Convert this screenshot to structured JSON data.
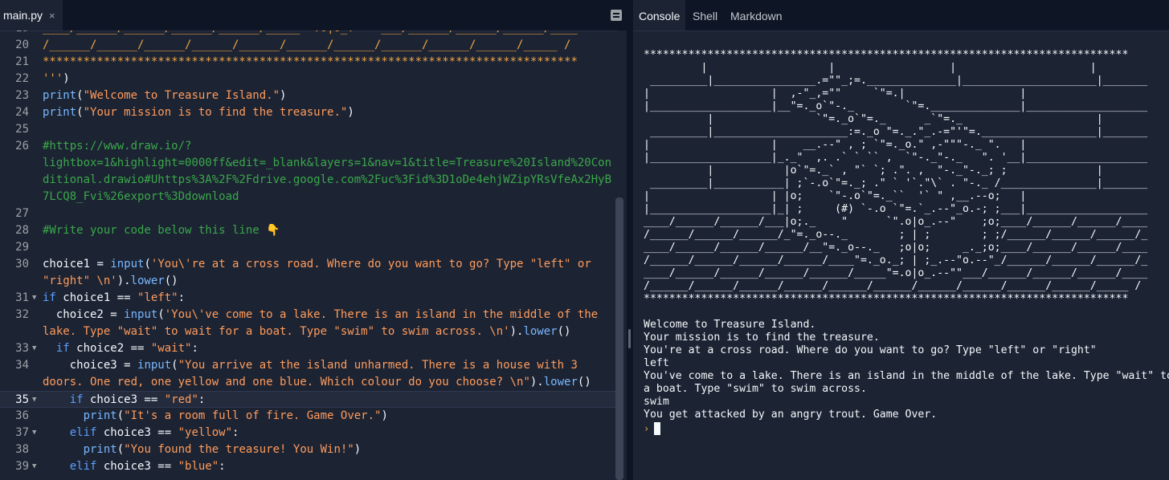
{
  "editor": {
    "file_tab": "main.py",
    "close_glyph": "×",
    "lines": [
      {
        "n": "19",
        "fold": false,
        "active": false,
        "parts": [
          {
            "t": "____/______/______/______/______/_____ =.o|o_.--  ___/______/______/______/____",
            "c": "c-orange"
          }
        ]
      },
      {
        "n": "20",
        "fold": false,
        "active": false,
        "parts": [
          {
            "t": "/______/______/______/______/______/______/______/______/______/______/_____ /",
            "c": "c-orange"
          }
        ]
      },
      {
        "n": "21",
        "fold": false,
        "active": false,
        "parts": [
          {
            "t": "*******************************************************************************",
            "c": "c-orange"
          }
        ]
      },
      {
        "n": "22",
        "fold": false,
        "active": false,
        "parts": [
          {
            "t": "'''",
            "c": "c-orange"
          },
          {
            "t": ")",
            "c": "c-def"
          }
        ]
      },
      {
        "n": "23",
        "fold": false,
        "active": false,
        "parts": [
          {
            "t": "print",
            "c": "c-call"
          },
          {
            "t": "(",
            "c": "c-def"
          },
          {
            "t": "\"Welcome to Treasure Island.\"",
            "c": "c-str"
          },
          {
            "t": ")",
            "c": "c-def"
          }
        ]
      },
      {
        "n": "24",
        "fold": false,
        "active": false,
        "parts": [
          {
            "t": "print",
            "c": "c-call"
          },
          {
            "t": "(",
            "c": "c-def"
          },
          {
            "t": "\"Your mission is to find the treasure.\"",
            "c": "c-str"
          },
          {
            "t": ")",
            "c": "c-def"
          }
        ]
      },
      {
        "n": "25",
        "fold": false,
        "active": false,
        "parts": []
      },
      {
        "n": "26",
        "fold": false,
        "active": false,
        "parts": [
          {
            "t": "#https://www.draw.io/?",
            "c": "c-com"
          }
        ]
      },
      {
        "n": "",
        "fold": false,
        "active": false,
        "parts": [
          {
            "t": "lightbox=1&highlight=0000ff&edit=_blank&layers=1&nav=1&title=Treasure%20Island%20Con",
            "c": "c-com"
          }
        ]
      },
      {
        "n": "",
        "fold": false,
        "active": false,
        "parts": [
          {
            "t": "ditional.drawio#Uhttps%3A%2F%2Fdrive.google.com%2Fuc%3Fid%3D1oDe4ehjWZipYRsVfeAx2HyB",
            "c": "c-com"
          }
        ]
      },
      {
        "n": "",
        "fold": false,
        "active": false,
        "parts": [
          {
            "t": "7LCQ8_Fvi%26export%3Ddownload",
            "c": "c-com"
          }
        ]
      },
      {
        "n": "27",
        "fold": false,
        "active": false,
        "parts": []
      },
      {
        "n": "28",
        "fold": false,
        "active": false,
        "parts": [
          {
            "t": "#Write your code below this line 👇",
            "c": "c-com"
          }
        ]
      },
      {
        "n": "29",
        "fold": false,
        "active": false,
        "parts": []
      },
      {
        "n": "30",
        "fold": false,
        "active": false,
        "parts": [
          {
            "t": "choice1",
            "c": "c-var"
          },
          {
            "t": " = ",
            "c": "c-def"
          },
          {
            "t": "input",
            "c": "c-call"
          },
          {
            "t": "(",
            "c": "c-def"
          },
          {
            "t": "'You\\'re at a cross road. Where do you want to go? Type \"left\" or",
            "c": "c-str"
          }
        ]
      },
      {
        "n": "",
        "fold": false,
        "active": false,
        "parts": [
          {
            "t": "\"right\" \\n'",
            "c": "c-str"
          },
          {
            "t": ").",
            "c": "c-def"
          },
          {
            "t": "lower",
            "c": "c-call"
          },
          {
            "t": "()",
            "c": "c-def"
          }
        ]
      },
      {
        "n": "31",
        "fold": true,
        "active": false,
        "parts": [
          {
            "t": "if",
            "c": "c-kw"
          },
          {
            "t": " choice1 == ",
            "c": "c-def"
          },
          {
            "t": "\"left\"",
            "c": "c-str"
          },
          {
            "t": ":",
            "c": "c-def"
          }
        ]
      },
      {
        "n": "32",
        "fold": false,
        "active": false,
        "parts": [
          {
            "t": "  choice2 = ",
            "c": "c-def"
          },
          {
            "t": "input",
            "c": "c-call"
          },
          {
            "t": "(",
            "c": "c-def"
          },
          {
            "t": "'You\\'ve come to a lake. There is an island in the middle of the",
            "c": "c-str"
          }
        ]
      },
      {
        "n": "",
        "fold": false,
        "active": false,
        "parts": [
          {
            "t": "lake. Type \"wait\" to wait for a boat. Type \"swim\" to swim across. \\n'",
            "c": "c-str"
          },
          {
            "t": ").",
            "c": "c-def"
          },
          {
            "t": "lower",
            "c": "c-call"
          },
          {
            "t": "()",
            "c": "c-def"
          }
        ]
      },
      {
        "n": "33",
        "fold": true,
        "active": false,
        "parts": [
          {
            "t": "  ",
            "c": "c-def"
          },
          {
            "t": "if",
            "c": "c-kw"
          },
          {
            "t": " choice2 == ",
            "c": "c-def"
          },
          {
            "t": "\"wait\"",
            "c": "c-str"
          },
          {
            "t": ":",
            "c": "c-def"
          }
        ]
      },
      {
        "n": "34",
        "fold": false,
        "active": false,
        "parts": [
          {
            "t": "    choice3 = ",
            "c": "c-def"
          },
          {
            "t": "input",
            "c": "c-call"
          },
          {
            "t": "(",
            "c": "c-def"
          },
          {
            "t": "\"You arrive at the island unharmed. There is a house with 3",
            "c": "c-str"
          }
        ]
      },
      {
        "n": "",
        "fold": false,
        "active": false,
        "parts": [
          {
            "t": "doors. One red, one yellow and one blue. Which colour do you choose? \\n\"",
            "c": "c-str"
          },
          {
            "t": ").",
            "c": "c-def"
          },
          {
            "t": "lower",
            "c": "c-call"
          },
          {
            "t": "()",
            "c": "c-def"
          }
        ]
      },
      {
        "n": "35",
        "fold": true,
        "active": true,
        "parts": [
          {
            "t": "    ",
            "c": "c-def"
          },
          {
            "t": "if",
            "c": "c-kw"
          },
          {
            "t": " choice3 == ",
            "c": "c-def"
          },
          {
            "t": "\"red\"",
            "c": "c-str"
          },
          {
            "t": ":",
            "c": "c-def"
          }
        ]
      },
      {
        "n": "36",
        "fold": false,
        "active": false,
        "parts": [
          {
            "t": "      ",
            "c": "c-def"
          },
          {
            "t": "print",
            "c": "c-call"
          },
          {
            "t": "(",
            "c": "c-def"
          },
          {
            "t": "\"It's a room full of fire. Game Over.\"",
            "c": "c-str"
          },
          {
            "t": ")",
            "c": "c-def"
          }
        ]
      },
      {
        "n": "37",
        "fold": true,
        "active": false,
        "parts": [
          {
            "t": "    ",
            "c": "c-def"
          },
          {
            "t": "elif",
            "c": "c-kw"
          },
          {
            "t": " choice3 == ",
            "c": "c-def"
          },
          {
            "t": "\"yellow\"",
            "c": "c-str"
          },
          {
            "t": ":",
            "c": "c-def"
          }
        ]
      },
      {
        "n": "38",
        "fold": false,
        "active": false,
        "parts": [
          {
            "t": "      ",
            "c": "c-def"
          },
          {
            "t": "print",
            "c": "c-call"
          },
          {
            "t": "(",
            "c": "c-def"
          },
          {
            "t": "\"You found the treasure! You Win!\"",
            "c": "c-str"
          },
          {
            "t": ")",
            "c": "c-def"
          }
        ]
      },
      {
        "n": "39",
        "fold": true,
        "active": false,
        "parts": [
          {
            "t": "    ",
            "c": "c-def"
          },
          {
            "t": "elif",
            "c": "c-kw"
          },
          {
            "t": " choice3 == ",
            "c": "c-def"
          },
          {
            "t": "\"blue\"",
            "c": "c-str"
          },
          {
            "t": ":",
            "c": "c-def"
          }
        ]
      }
    ]
  },
  "console": {
    "tabs": [
      "Console",
      "Shell",
      "Markdown"
    ],
    "output": "****************************************************************************\n         |                   |                  |                     |\n _________|________________.=\"\"_;=.______________|_____________________|_______\n|                   |  ,-\"_,=\"\"     `\"=.|                  |\n|___________________|__\"=._o`\"-._        `\"=.______________|___________________\n          |                `\"=._o`\"=._      _`\"=._                     |\n _________|_____________________:=._o \"=._.\"_.-=\"'\"=.__________________|_______\n|                   |    __.--\" , ; `\"=._o.\" ,-\"\"\"-._ \".   |\n|___________________|_._\"  ,. .` ` `` ,  `\"-._\"-._   \". '__|___________________\n          |           |o`\"=._` , \"` `; .\". ,  \"-._\"-._; ;              |\n _________|___________| ;`-.o`\"=._; .\" ` '`.\"\\` . \"-._ /_______________|_______\n|                   | |o;    `\"-.o`\"=._``  '` \" ,__.--o;   |\n|___________________|_| ;     (#) `-.o `\"=.`_.--\"_o.-; ;___|___________________\n____/______/______/___|o;._    \"      `\".o|o_.--\"    ;o;____/______/______/____\n/______/______/______/_\"=._o--._        ; | ;        ; ;/______/______/______/_\n____/______/______/______/__\"=._o--._   ;o|o;     _._;o;____/______/______/____\n/______/______/______/______/____\"=._o._; | ;_.--\"o.--\"_/______/______/______/_\n____/______/______/______/______/_____\"=.o|o_.--\"\"___/______/______/______/____\n/______/______/______/______/______/______/______/______/______/______/_____ /\n****************************************************************************\n\nWelcome to Treasure Island.\nYour mission is to find the treasure.\nYou're at a cross road. Where do you want to go? Type \"left\" or \"right\"\nleft\nYou've come to a lake. There is an island in the middle of the lake. Type \"wait\" to wait for\na boat. Type \"swim\" to swim across.\nswim\nYou get attacked by an angry trout. Game Over.",
    "prompt_glyph": "›"
  }
}
